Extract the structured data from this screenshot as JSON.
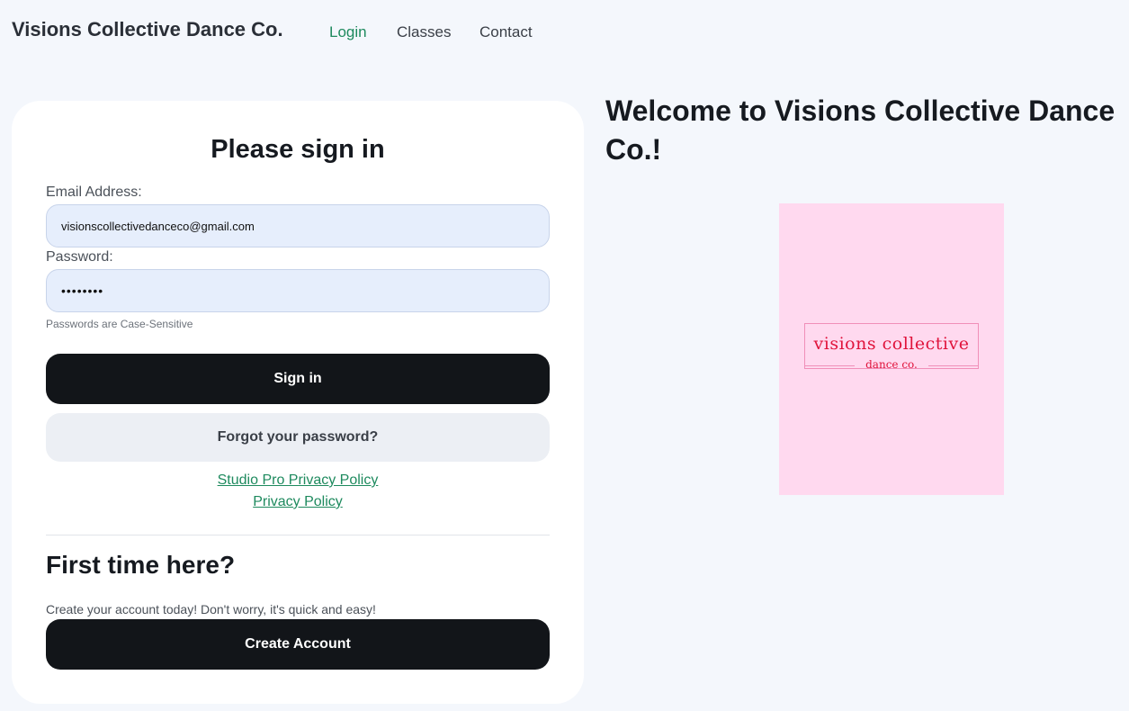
{
  "header": {
    "brand": "Visions Collective Dance Co.",
    "nav": [
      {
        "label": "Login",
        "active": true
      },
      {
        "label": "Classes",
        "active": false
      },
      {
        "label": "Contact",
        "active": false
      }
    ]
  },
  "signin": {
    "title": "Please sign in",
    "email_label": "Email Address:",
    "email_value": "visionscollectivedanceco@gmail.com",
    "password_label": "Password:",
    "password_value": "••••••••",
    "hint": "Passwords are Case-Sensitive",
    "signin_button": "Sign in",
    "forgot_button": "Forgot your password?",
    "policy_links": [
      "Studio Pro Privacy Policy",
      "Privacy Policy"
    ]
  },
  "signup": {
    "title": "First time here?",
    "text": "Create your account today! Don't worry, it's quick and easy!",
    "button": "Create Account"
  },
  "main": {
    "welcome": "Welcome to Visions Collective Dance Co.!",
    "logo": {
      "line1": "visions collective",
      "line2": "dance co."
    }
  },
  "colors": {
    "accent": "#1e8a5e",
    "button_dark": "#121519",
    "logo_bg": "#ffd9ef",
    "logo_text": "#e0133b"
  }
}
